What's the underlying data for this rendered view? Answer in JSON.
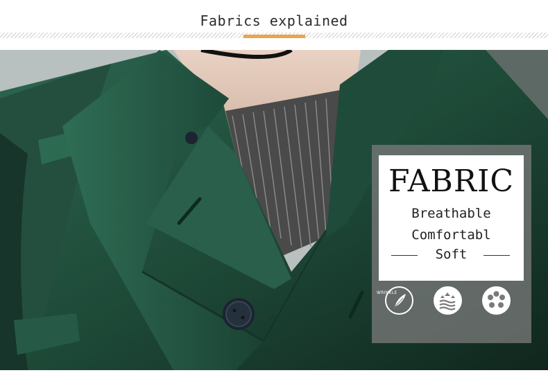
{
  "header": {
    "title": "Fabrics explained"
  },
  "card": {
    "heading": "FABRIC",
    "features": [
      "Breathable",
      "Comfortabl",
      "Soft"
    ],
    "icons": [
      {
        "name": "feather-icon",
        "label": "WRINKLE"
      },
      {
        "name": "airflow-icon"
      },
      {
        "name": "flower-icon"
      }
    ]
  },
  "colors": {
    "coat": "#1e4a38",
    "accent": "#e8a54b",
    "card_overlay": "#7a7a7a"
  }
}
